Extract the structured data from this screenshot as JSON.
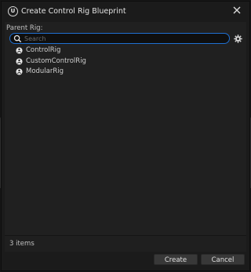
{
  "window": {
    "title": "Create Control Rig Blueprint",
    "logo_icon": "unreal-engine-logo-icon",
    "close_icon": "close-icon"
  },
  "picker": {
    "label": "Parent Rig:",
    "search": {
      "placeholder": "Search",
      "value": ""
    },
    "settings_icon": "gear-icon",
    "items": [
      {
        "label": "ControlRig",
        "icon": "control-rig-class-icon"
      },
      {
        "label": "CustomControlRig",
        "icon": "control-rig-class-icon"
      },
      {
        "label": "ModularRig",
        "icon": "control-rig-class-icon"
      }
    ],
    "count_text": "3 items"
  },
  "footer": {
    "create_label": "Create",
    "cancel_label": "Cancel"
  },
  "colors": {
    "accent": "#1f6fd1",
    "background": "#202020",
    "button": "#383838"
  }
}
